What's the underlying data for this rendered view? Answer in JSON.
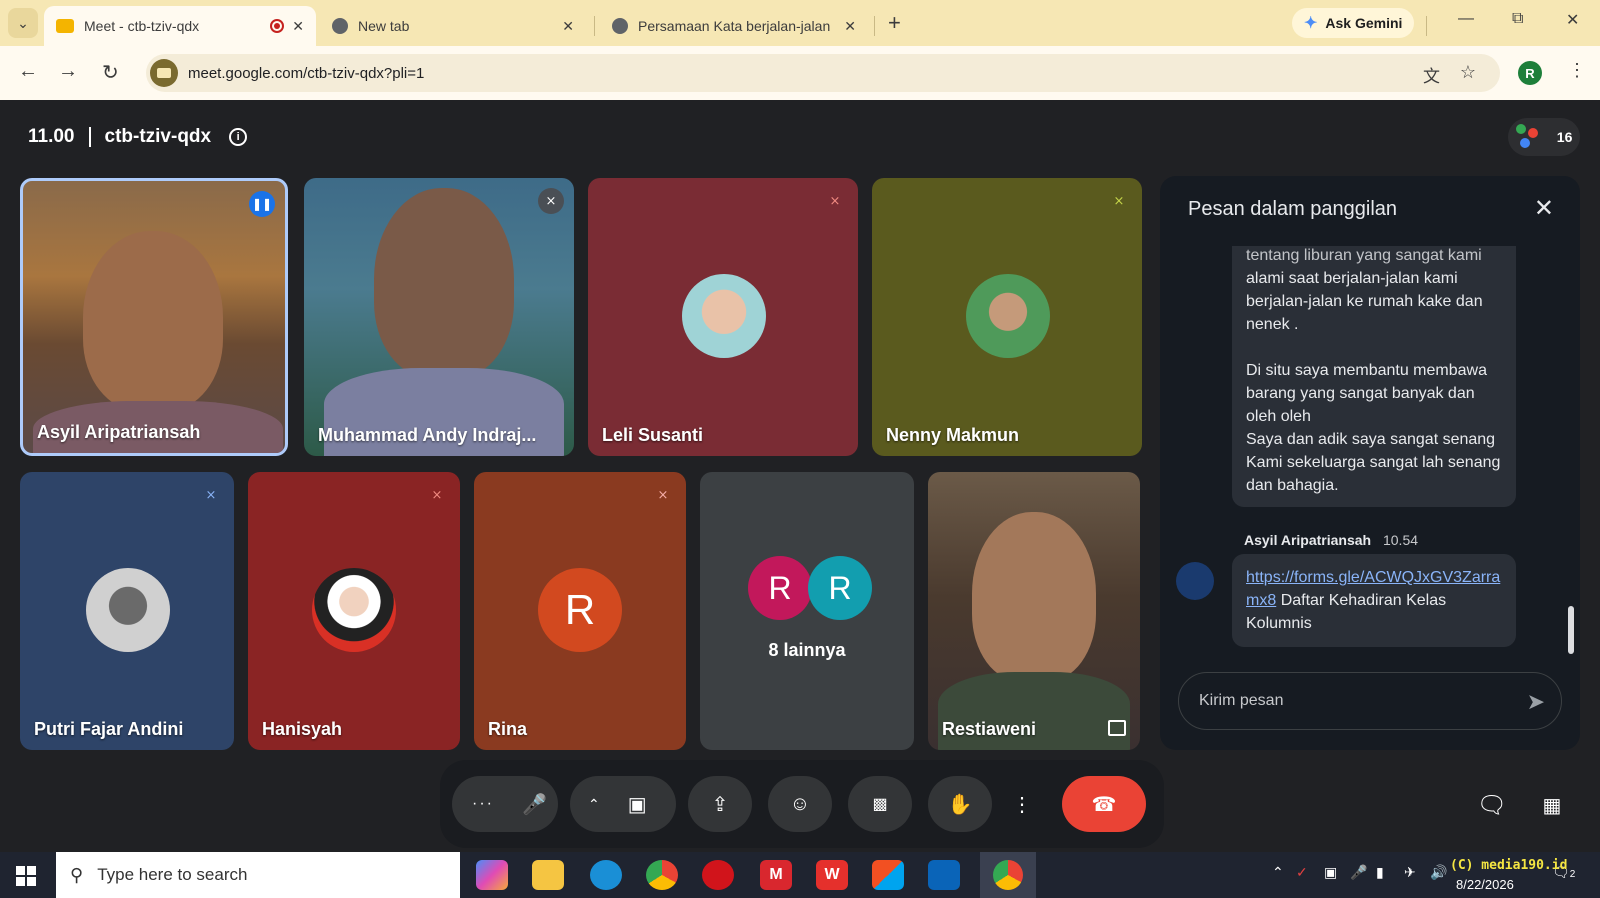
{
  "browser": {
    "tabs": [
      {
        "title": "Meet - ctb-tziv-qdx",
        "active": true,
        "recording": true
      },
      {
        "title": "New tab",
        "active": false
      },
      {
        "title": "Persamaan Kata berjalan-jalan",
        "active": false
      }
    ],
    "new_tab_label": "+",
    "gemini_label": "Ask Gemini",
    "url": "meet.google.com/ctb-tziv-qdx?pli=1",
    "profile_initial": "R"
  },
  "meeting": {
    "time": "11.00",
    "code": "ctb-tziv-qdx",
    "participant_count": "16"
  },
  "tiles": [
    {
      "name": "Asyil Aripatriansah",
      "speaking": true
    },
    {
      "name": "Muhammad Andy Indraj...",
      "muted": true
    },
    {
      "name": "Leli Susanti",
      "muted": true
    },
    {
      "name": "Nenny Makmun",
      "muted": true
    },
    {
      "name": "Putri Fajar Andini",
      "muted": true
    },
    {
      "name": "Hanisyah",
      "muted": true
    },
    {
      "name": "Rina",
      "initial": "R",
      "muted": true
    },
    {
      "name": "8 lainnya",
      "initials": [
        "R",
        "R"
      ]
    },
    {
      "name": "Restiaweni"
    }
  ],
  "chat": {
    "title": "Pesan dalam panggilan",
    "message1": {
      "partial_top": "tentang liburan yang sangat kami",
      "para1": "alami saat berjalan-jalan kami berjalan-jalan ke rumah kake dan nenek .",
      "para2": "Di situ saya membantu membawa barang yang sangat banyak dan oleh oleh",
      "para3": "Saya dan adik saya sangat senang Kami sekeluarga sangat lah senang dan bahagia."
    },
    "message2": {
      "sender": "Asyil Aripatriansah",
      "time": "10.54",
      "link": "https://forms.gle/ACWQJxGV3Zarramx8",
      "text": "Daftar Kehadiran Kelas Kolumnis"
    },
    "input_placeholder": "Kirim pesan"
  },
  "taskbar": {
    "search_placeholder": "Type here to search",
    "date": "8/22/2026",
    "watermark": "(C) media190.id",
    "notification_count": "2"
  },
  "colors": {
    "meet_bg": "#202124",
    "end_call": "#ea4335",
    "tab_strip": "#f6e7b4"
  }
}
